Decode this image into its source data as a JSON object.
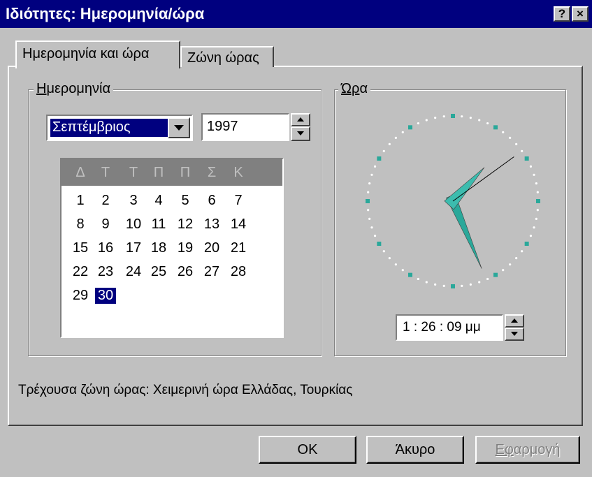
{
  "window": {
    "title": "Ιδιότητες: Ημερομηνία/ώρα",
    "help_label": "?",
    "close_label": "×"
  },
  "tabs": [
    {
      "label": "Ημερομηνία και ώρα",
      "active": true
    },
    {
      "label": "Ζώνη ώρας",
      "active": false
    }
  ],
  "date_group": {
    "label": "Ημερομηνία",
    "month": "Σεπτέμβριος",
    "year": "1997",
    "weekdays": [
      "Δ",
      "Τ",
      "Τ",
      "Π",
      "Π",
      "Σ",
      "Κ"
    ],
    "weeks": [
      [
        "1",
        "2",
        "3",
        "4",
        "5",
        "6",
        "7"
      ],
      [
        "8",
        "9",
        "10",
        "11",
        "12",
        "13",
        "14"
      ],
      [
        "15",
        "16",
        "17",
        "18",
        "19",
        "20",
        "21"
      ],
      [
        "22",
        "23",
        "24",
        "25",
        "26",
        "27",
        "28"
      ],
      [
        "29",
        "30"
      ]
    ],
    "selected_day": "30"
  },
  "time_group": {
    "label": "Ώρα",
    "time_value": "1 : 26 : 09 μμ",
    "clock": {
      "hours": 1,
      "minutes": 26,
      "seconds": 9
    }
  },
  "timezone_text": "Τρέχουσα ζώνη ώρας:  Χειμερινή ώρα Ελλάδας, Τουρκίας",
  "buttons": {
    "ok": "OK",
    "cancel": "Άκυρο",
    "apply": "Εφαρμογή"
  },
  "colors": {
    "titlebar": "#00007f",
    "face": "#c0c0c0",
    "clock_marker": "#2aa89a",
    "clock_hand": "#2aa89a"
  }
}
